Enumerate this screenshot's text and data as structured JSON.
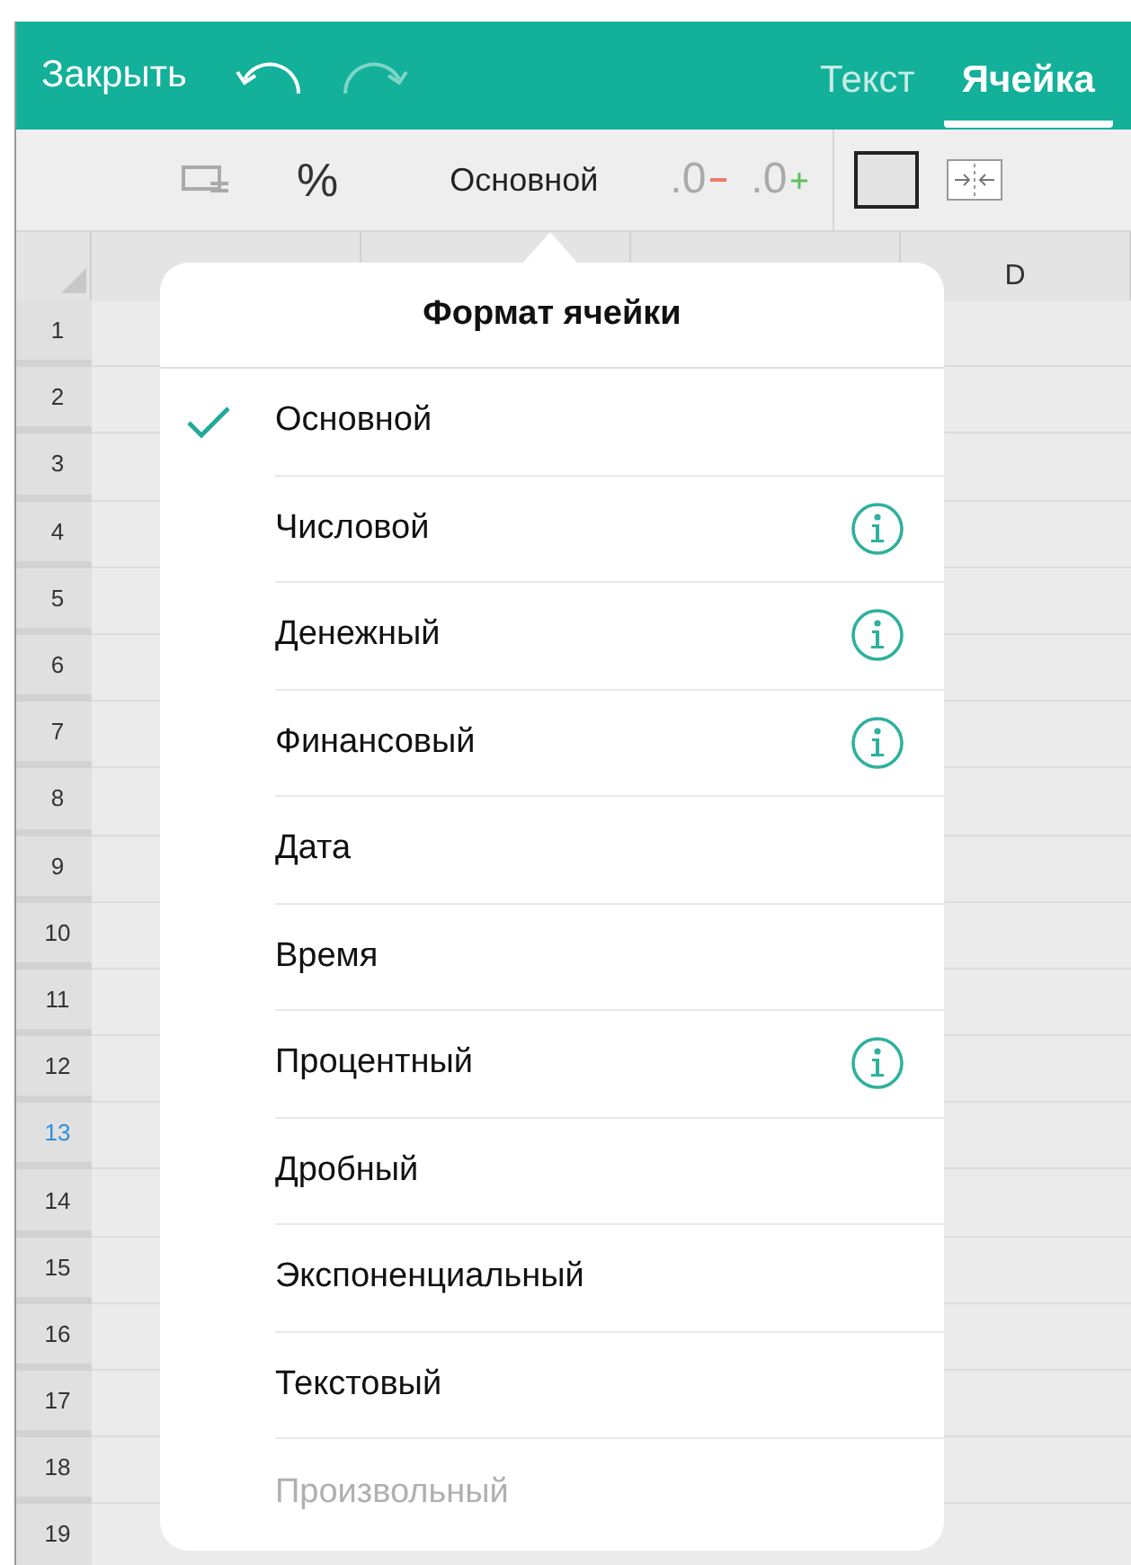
{
  "header": {
    "close": "Закрыть",
    "tabs": [
      {
        "label": "Текст",
        "selected": false
      },
      {
        "label": "Ячейка",
        "selected": true
      }
    ]
  },
  "toolbar": {
    "percent": "%",
    "format": "Основной",
    "decrease_decimals": ".0",
    "increase_decimals": ".0"
  },
  "sheet": {
    "column_d": "D",
    "rows": [
      {
        "label": "1",
        "selected": false
      },
      {
        "label": "2",
        "selected": false
      },
      {
        "label": "3",
        "selected": false
      },
      {
        "label": "4",
        "selected": false
      },
      {
        "label": "5",
        "selected": false
      },
      {
        "label": "6",
        "selected": false
      },
      {
        "label": "7",
        "selected": false
      },
      {
        "label": "8",
        "selected": false
      },
      {
        "label": "9",
        "selected": false
      },
      {
        "label": "10",
        "selected": false
      },
      {
        "label": "11",
        "selected": false
      },
      {
        "label": "12",
        "selected": false
      },
      {
        "label": "13",
        "selected": true
      },
      {
        "label": "14",
        "selected": false
      },
      {
        "label": "15",
        "selected": false
      },
      {
        "label": "16",
        "selected": false
      },
      {
        "label": "17",
        "selected": false
      },
      {
        "label": "18",
        "selected": false
      },
      {
        "label": "19",
        "selected": false
      }
    ]
  },
  "popover": {
    "title": "Формат ячейки",
    "items": [
      {
        "label": "Основной",
        "selected": true,
        "info": false,
        "disabled": false
      },
      {
        "label": "Числовой",
        "selected": false,
        "info": true,
        "disabled": false
      },
      {
        "label": "Денежный",
        "selected": false,
        "info": true,
        "disabled": false
      },
      {
        "label": "Финансовый",
        "selected": false,
        "info": true,
        "disabled": false
      },
      {
        "label": "Дата",
        "selected": false,
        "info": false,
        "disabled": false
      },
      {
        "label": "Время",
        "selected": false,
        "info": false,
        "disabled": false
      },
      {
        "label": "Процентный",
        "selected": false,
        "info": true,
        "disabled": false
      },
      {
        "label": "Дробный",
        "selected": false,
        "info": false,
        "disabled": false
      },
      {
        "label": "Экспоненциальный",
        "selected": false,
        "info": false,
        "disabled": false
      },
      {
        "label": "Текстовый",
        "selected": false,
        "info": false,
        "disabled": false
      },
      {
        "label": "Произвольный",
        "selected": false,
        "info": false,
        "disabled": true
      }
    ]
  }
}
